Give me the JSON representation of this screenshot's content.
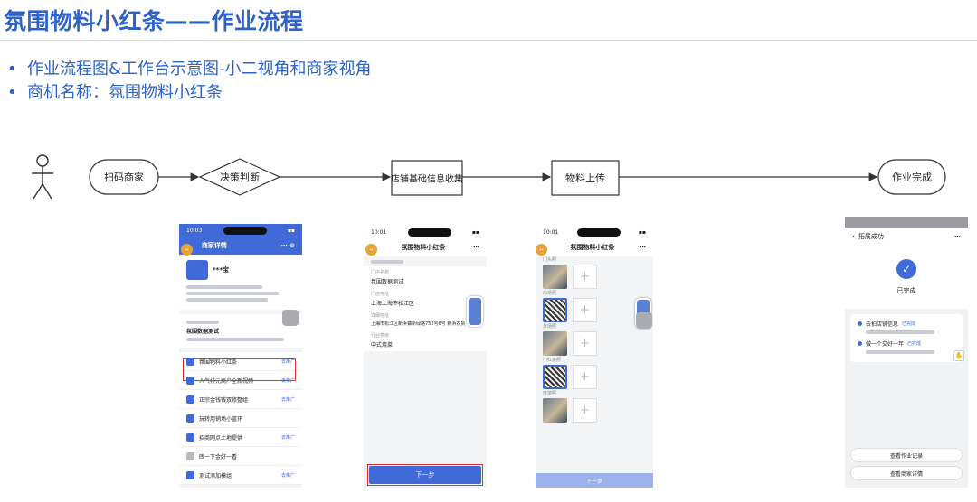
{
  "title": "氛围物料小红条——作业流程",
  "bullets": [
    "作业流程图&工作台示意图-小二视角和商家视角",
    "商机名称：氛围物料小红条"
  ],
  "flow": {
    "nodes": [
      "扫码商家",
      "决策判断",
      "店铺基础信息收集",
      "物料上传",
      "作业完成"
    ]
  },
  "colors": {
    "accent": "#2d63c8",
    "highlight": "#e0302a",
    "phone_blue": "#3f6ad8"
  },
  "phone1": {
    "time": "10:03",
    "header": "商家详情",
    "store_name": "***宝",
    "store_test": "氛围数据测试",
    "items": [
      {
        "label": "氛围物料小红条",
        "tag": "去推广"
      },
      {
        "label": "人气排元商户全新视频",
        "tag": "去推广"
      },
      {
        "label": "正宗金钱钱双修整组",
        "tag": "去推广"
      },
      {
        "label": "玩转用销场小蓝环",
        "tag": ""
      },
      {
        "label": "招商网点土地提供",
        "tag": "去推广"
      },
      {
        "label": "砖一下金好一看",
        "tag": ""
      },
      {
        "label": "测试添加模组",
        "tag": "去推广"
      }
    ]
  },
  "phone2": {
    "time": "10:01",
    "header": "氛围物料小红条",
    "fields": [
      {
        "label": "门店名称",
        "value": "氛围数据测试"
      },
      {
        "label": "门店地址",
        "value": "上海上海市松江区"
      },
      {
        "label": "详细地址",
        "value": "上海市松江区新浜镇新绿路752号6号  新浜农贸"
      },
      {
        "label": "行业类目",
        "value": "中式烧菜"
      }
    ],
    "button": "下一步"
  },
  "phone3": {
    "time": "10:01",
    "header": "氛围物料小红条",
    "sections": [
      "门头照",
      "内场照",
      "外场照",
      "小红条照",
      "环境照"
    ],
    "button": "下一步"
  },
  "phone4": {
    "header": "拓展成功",
    "done": "已完成",
    "steps": [
      {
        "name": "去拍店铺信息",
        "status": "已完成"
      },
      {
        "name": "做一个交好一年",
        "status": "已完成"
      }
    ],
    "buttons": [
      "查看作业记录",
      "查看商家详情"
    ]
  }
}
